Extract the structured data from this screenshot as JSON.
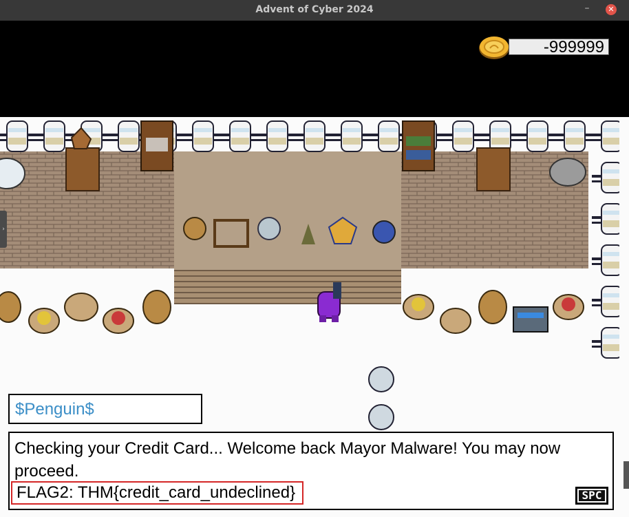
{
  "window": {
    "title": "Advent of Cyber 2024",
    "minimize_glyph": "–",
    "close_glyph": "✕"
  },
  "hud": {
    "coins": "-999999",
    "coin_icon": "gold-coin-icon"
  },
  "dialog": {
    "speaker": "$Penguin$",
    "message": "Checking your Credit Card... Welcome back Mayor Malware! You may now proceed.",
    "flag": "FLAG2: THM{credit_card_undeclined}",
    "advance_key": "SPC"
  },
  "colors": {
    "speaker_name": "#3b8ec7",
    "flag_highlight": "#d42626",
    "player": "#8a2bd1"
  }
}
